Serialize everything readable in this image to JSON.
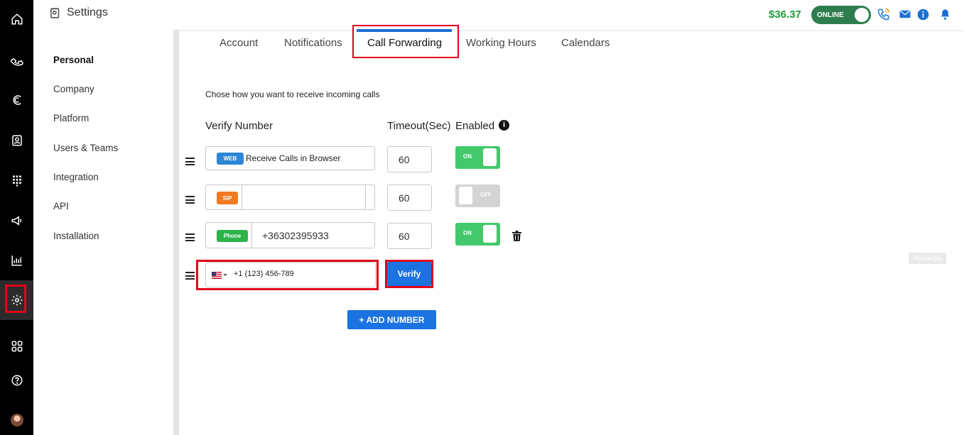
{
  "header": {
    "title": "Settings",
    "balance": "$36.37",
    "status_label": "ONLINE"
  },
  "sidebar": {
    "items": [
      {
        "label": "Personal",
        "active": true
      },
      {
        "label": "Company"
      },
      {
        "label": "Platform"
      },
      {
        "label": "Users & Teams"
      },
      {
        "label": "Integration"
      },
      {
        "label": "API"
      },
      {
        "label": "Installation"
      }
    ]
  },
  "tabs": [
    {
      "label": "Account"
    },
    {
      "label": "Notifications"
    },
    {
      "label": "Call Forwarding",
      "active": true
    },
    {
      "label": "Working Hours"
    },
    {
      "label": "Calendars"
    }
  ],
  "main": {
    "description": "Chose how you want to receive incoming calls",
    "headers": {
      "verify_number": "Verify Number",
      "timeout": "Timeout(Sec)",
      "enabled": "Enabled"
    },
    "rows": [
      {
        "badge": "WEB",
        "badge_color": "#2d86d6",
        "number": "Receive Calls in Browser",
        "timeout": "60",
        "enabled": true,
        "toggle_label": "ON"
      },
      {
        "badge": "SIP",
        "badge_color": "#f07b22",
        "number": "",
        "timeout": "60",
        "enabled": false,
        "toggle_label": "OFF"
      },
      {
        "badge": "Phone",
        "badge_color": "#2db34a",
        "number": "+36302395933",
        "timeout": "60",
        "enabled": true,
        "toggle_label": "ON"
      }
    ],
    "new_number": {
      "country": "US",
      "value": "+1 (123) 456-789"
    },
    "verify_label": "Verify",
    "add_number_label": "+ ADD NUMBER",
    "rectangle_tag": "Rectangle"
  },
  "colors": {
    "accent": "#1a73e0",
    "highlight": "#e0001b",
    "toggle_on": "#43c96b",
    "balance": "#1f9d3a"
  },
  "icons": {
    "rail": [
      "home-icon",
      "phone-icon",
      "callback-icon",
      "contacts-icon",
      "dialpad-icon",
      "megaphone-icon",
      "analytics-icon",
      "settings-icon",
      "apps-icon",
      "help-icon",
      "avatar"
    ],
    "top": [
      "settings-page-icon",
      "phone-ring-icon",
      "mail-icon",
      "info-icon",
      "bell-icon"
    ]
  }
}
